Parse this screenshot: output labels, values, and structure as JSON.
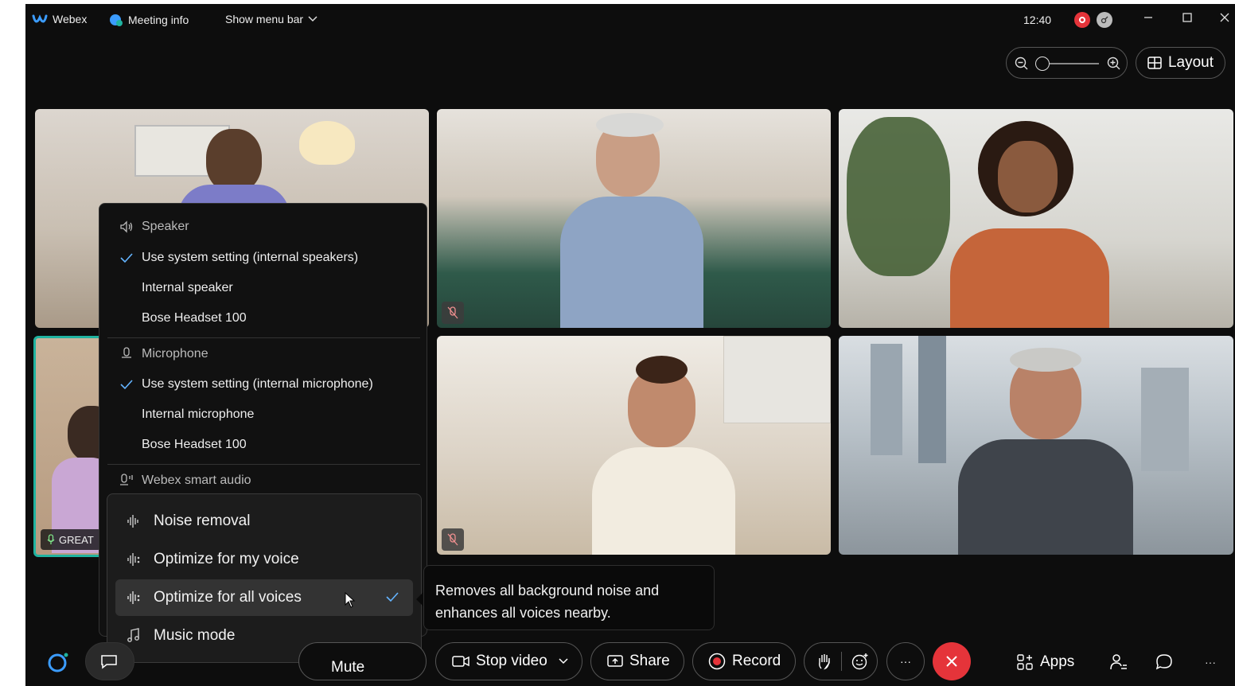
{
  "titlebar": {
    "app_name": "Webex",
    "meeting_info": "Meeting info",
    "show_menu_bar": "Show menu bar",
    "time": "12:40"
  },
  "toolbar_top": {
    "layout_label": "Layout"
  },
  "participants": {
    "network_quality": "GREAT"
  },
  "audio_menu": {
    "speaker_header": "Speaker",
    "speaker_options": [
      "Use system setting (internal speakers)",
      "Internal speaker",
      "Bose Headset 100"
    ],
    "speaker_selected_index": 0,
    "microphone_header": "Microphone",
    "microphone_options": [
      "Use system setting (internal microphone)",
      "Internal microphone",
      "Bose Headset 100"
    ],
    "microphone_selected_index": 0,
    "smart_audio_header": "Webex smart audio",
    "smart_audio_options": [
      "Noise removal",
      "Optimize for my voice",
      "Optimize for all voices",
      "Music mode"
    ],
    "smart_audio_selected_index": 2,
    "tooltip_line1": "Removes all background noise and",
    "tooltip_line2": "enhances all voices nearby."
  },
  "controls": {
    "mute_label": "Mute",
    "stop_video_label": "Stop video",
    "share_label": "Share",
    "record_label": "Record",
    "more_label": "···",
    "apps_label": "Apps",
    "overflow_label": "···"
  },
  "colors": {
    "accent_teal": "#1fb3a0",
    "end_call_red": "#e5343a",
    "record_red": "#e5343a",
    "check_blue": "#64b4ff"
  }
}
